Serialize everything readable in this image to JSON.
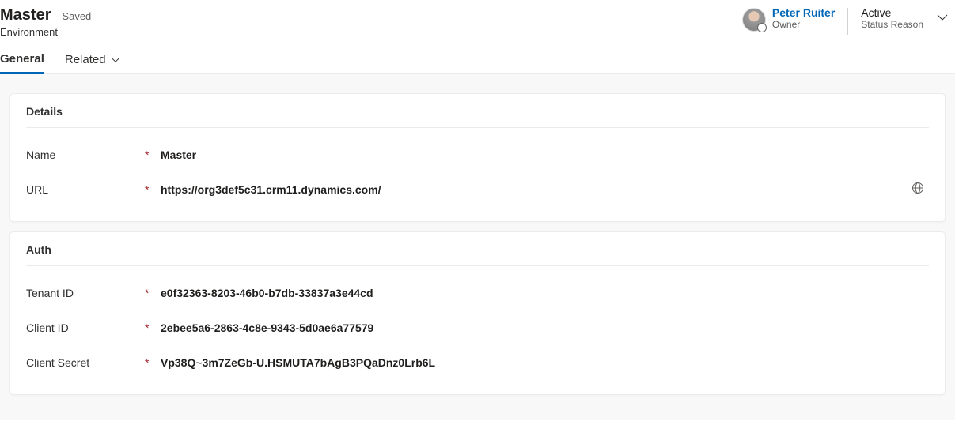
{
  "header": {
    "title": "Master",
    "saved_suffix": "- Saved",
    "entity": "Environment",
    "owner_name": "Peter Ruiter",
    "owner_role": "Owner",
    "status": "Active",
    "status_reason_label": "Status Reason"
  },
  "tabs": {
    "general": "General",
    "related": "Related"
  },
  "sections": {
    "details": {
      "title": "Details",
      "fields": {
        "name": {
          "label": "Name",
          "value": "Master"
        },
        "url": {
          "label": "URL",
          "value": "https://org3def5c31.crm11.dynamics.com/"
        }
      }
    },
    "auth": {
      "title": "Auth",
      "fields": {
        "tenant_id": {
          "label": "Tenant ID",
          "value": "e0f32363-8203-46b0-b7db-33837a3e44cd"
        },
        "client_id": {
          "label": "Client ID",
          "value": "2ebee5a6-2863-4c8e-9343-5d0ae6a77579"
        },
        "client_secret": {
          "label": "Client Secret",
          "value": "Vp38Q~3m7ZeGb-U.HSMUTA7bAgB3PQaDnz0Lrb6L"
        }
      }
    }
  },
  "required_marker": "*"
}
